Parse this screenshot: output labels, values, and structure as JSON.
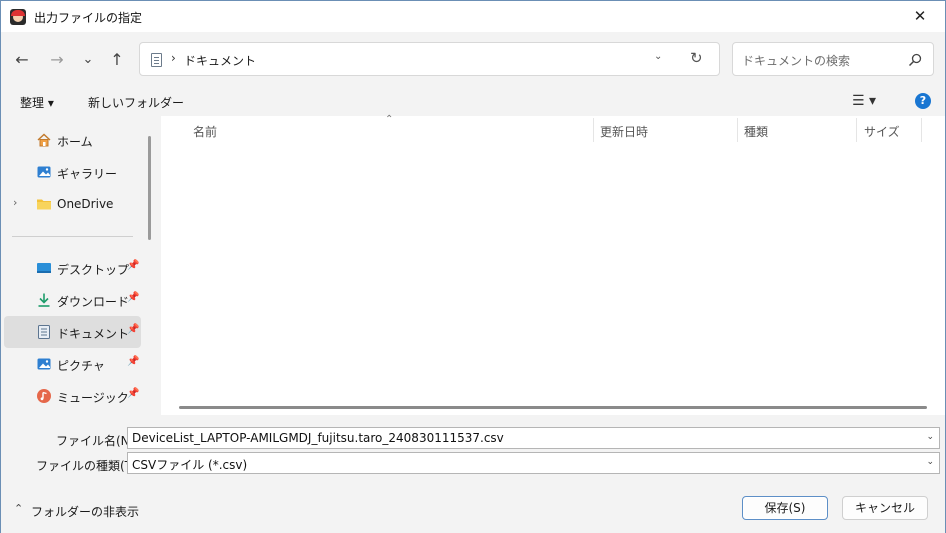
{
  "window": {
    "title": "出力ファイルの指定",
    "close_glyph": "✕"
  },
  "nav": {
    "back_glyph": "←",
    "forward_glyph": "→",
    "recent_glyph": "⌄",
    "up_glyph": "↑",
    "address": {
      "separator": "›",
      "location": "ドキュメント",
      "dropdown_glyph": "⌄",
      "refresh_glyph": "↻"
    },
    "search": {
      "placeholder": "ドキュメントの検索"
    }
  },
  "toolbar": {
    "organize_label": "整理 ▾",
    "new_folder_label": "新しいフォルダー",
    "view_glyph": "☰ ▾",
    "help_glyph": "?"
  },
  "sidebar": {
    "items": [
      {
        "label": "ホーム",
        "icon": "home-icon"
      },
      {
        "label": "ギャラリー",
        "icon": "gallery-icon"
      },
      {
        "label": "OneDrive",
        "icon": "folder-icon",
        "expand": "›"
      },
      {
        "label": "デスクトップ",
        "icon": "desktop-icon",
        "pin": "📌"
      },
      {
        "label": "ダウンロード",
        "icon": "download-icon",
        "pin": "📌"
      },
      {
        "label": "ドキュメント",
        "icon": "document-icon",
        "pin": "📌"
      },
      {
        "label": "ピクチャ",
        "icon": "pictures-icon",
        "pin": "📌"
      },
      {
        "label": "ミュージック",
        "icon": "music-icon",
        "pin": "📌"
      }
    ],
    "selected_index": 5
  },
  "columns": {
    "sort_glyph": "⌃",
    "name": "名前",
    "modified": "更新日時",
    "type": "種類",
    "size": "サイズ"
  },
  "form": {
    "filename_label": "ファイル名(N):",
    "filename_value": "DeviceList_LAPTOP-AMILGMDJ_fujitsu.taro_240830111537.csv",
    "filetype_label": "ファイルの種類(T):",
    "filetype_value": "CSVファイル (*.csv)",
    "chevron_glyph": "⌄"
  },
  "footer": {
    "hide_folders_label": "フォルダーの非表示",
    "hide_glyph": "⌃",
    "save_label": "保存(S)",
    "cancel_label": "キャンセル"
  },
  "colors": {
    "accent": "#1976d2",
    "selection": "#dedede",
    "primary_border": "#5d8fc7"
  }
}
